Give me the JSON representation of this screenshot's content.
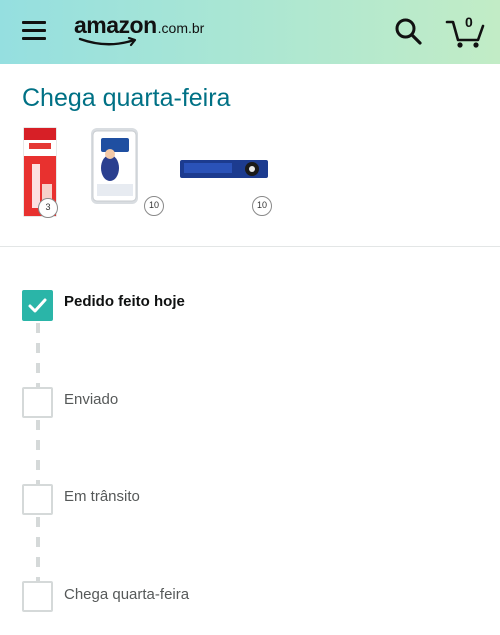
{
  "header": {
    "logo_word": "amazon",
    "logo_domain": ".com.br",
    "cart_count": "0",
    "icons": {
      "menu": "menu-icon",
      "search": "search-icon",
      "cart": "cart-icon"
    },
    "gradient_colors": [
      "#95dfe0",
      "#c2ecc6"
    ]
  },
  "delivery": {
    "title": "Chega quarta-feira",
    "title_color": "#007185",
    "items": [
      {
        "brand": "Piracanjuba",
        "product_label": "Integral",
        "qty": "3"
      },
      {
        "brand": "Nestlé",
        "product_label": "Moça",
        "qty": "10"
      },
      {
        "brand": "Negresco",
        "product_label": "negresco",
        "qty": "10"
      }
    ]
  },
  "tracking": {
    "accent_color": "#2ab5a8",
    "steps": [
      {
        "label": "Pedido feito hoje",
        "done": true
      },
      {
        "label": "Enviado",
        "done": false
      },
      {
        "label": "Em trânsito",
        "done": false
      },
      {
        "label": "Chega quarta-feira",
        "done": false
      }
    ]
  }
}
